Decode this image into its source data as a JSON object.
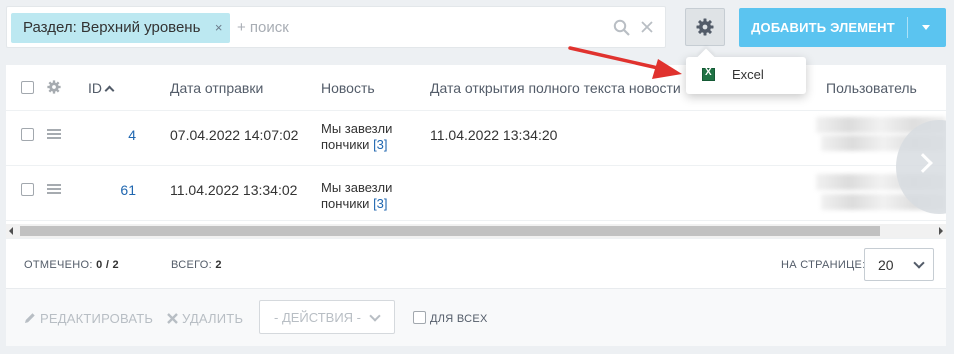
{
  "filter": {
    "tag_label": "Раздел: Верхний уровень",
    "tag_remove": "×",
    "search_placeholder": "+ поиск",
    "clear_label": "×"
  },
  "toolbar": {
    "add_label": "ДОБАВИТЬ ЭЛЕМЕНТ"
  },
  "popup": {
    "items": [
      {
        "label": "Excel",
        "icon": "excel-icon"
      }
    ]
  },
  "grid": {
    "columns": [
      "ID",
      "Дата отправки",
      "Новость",
      "Дата открытия полного текста новости",
      "Пользователь"
    ],
    "rows": [
      {
        "id": "4",
        "sent": "07.04.2022 14:07:02",
        "news": "Мы завезли пончики",
        "news_count": "[3]",
        "opened": "11.04.2022 13:34:20"
      },
      {
        "id": "61",
        "sent": "11.04.2022 13:34:02",
        "news": "Мы завезли пончики",
        "news_count": "[3]",
        "opened": ""
      }
    ]
  },
  "footer": {
    "checked_label": "ОТМЕЧЕНО:",
    "checked_value": "0 / 2",
    "total_label": "ВСЕГО:",
    "total_value": "2",
    "per_page_label": "НА СТРАНИЦЕ:",
    "per_page_value": "20"
  },
  "actions": {
    "edit_label": "РЕДАКТИРОВАТЬ",
    "delete_label": "УДАЛИТЬ",
    "select_value": "- ДЕЙСТВИЯ -",
    "for_all_label": "ДЛЯ ВСЕХ"
  },
  "colors": {
    "accent": "#5bc4f0",
    "tag_bg": "#bce8f1",
    "link": "#2067b0",
    "arrow": "#e0322e"
  }
}
